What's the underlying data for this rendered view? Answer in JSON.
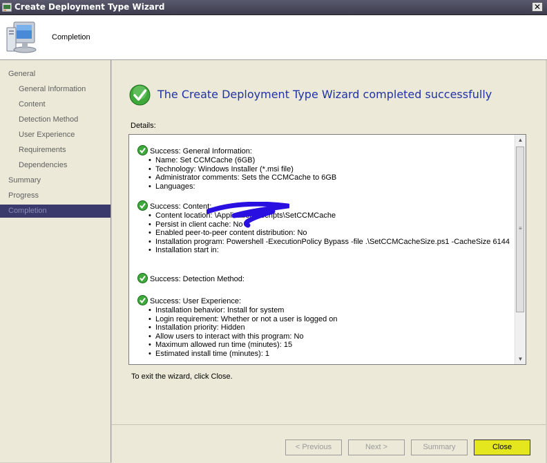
{
  "window": {
    "title": "Create Deployment Type Wizard",
    "close_glyph": "✕"
  },
  "header": {
    "heading": "Completion"
  },
  "nav": {
    "items": [
      {
        "label": "General",
        "level": "top"
      },
      {
        "label": "General Information",
        "level": "sub"
      },
      {
        "label": "Content",
        "level": "sub"
      },
      {
        "label": "Detection Method",
        "level": "sub"
      },
      {
        "label": "User Experience",
        "level": "sub"
      },
      {
        "label": "Requirements",
        "level": "sub"
      },
      {
        "label": "Dependencies",
        "level": "sub"
      },
      {
        "label": "Summary",
        "level": "top"
      },
      {
        "label": "Progress",
        "level": "top"
      },
      {
        "label": "Completion",
        "level": "top",
        "active": true
      }
    ]
  },
  "main": {
    "success_heading": "The Create Deployment Type Wizard completed successfully",
    "details_label": "Details:",
    "sections": [
      {
        "title": "Success: General Information:",
        "items": [
          "Name: Set CCMCache (6GB)",
          "Technology: Windows Installer (*.msi file)",
          "Administrator comments:  Sets the CCMCache to 6GB",
          "Languages:"
        ]
      },
      {
        "title": "Success: Content:",
        "items": [
          "Content location:                              \\Applications\\Scripts\\SetCCMCache",
          "Persist in client cache: No",
          "Enabled peer-to-peer content distribution: No",
          "Installation program: Powershell -ExecutionPolicy Bypass -file .\\SetCCMCacheSize.ps1 -CacheSize 6144",
          "Installation start in:"
        ]
      },
      {
        "title": "Success: Detection Method:",
        "items": []
      },
      {
        "title": "Success: User Experience:",
        "items": [
          "Installation behavior: Install for system",
          "Login requirement: Whether or not a user is logged on",
          "Installation priority: Hidden",
          "Allow users to interact with this program: No",
          "Maximum allowed run time (minutes): 15",
          "Estimated install time (minutes): 1"
        ]
      }
    ],
    "exit_text": "To exit the wizard, click Close."
  },
  "footer": {
    "previous_label": "< Previous",
    "next_label": "Next >",
    "summary_label": "Summary",
    "close_label": "Close"
  },
  "colors": {
    "heading_blue": "#1f32a6",
    "active_nav": "#3a3a6c",
    "highlight_yellow": "#e5e71e",
    "check_green": "#3ea83a",
    "redaction_blue": "#2a10e0"
  }
}
